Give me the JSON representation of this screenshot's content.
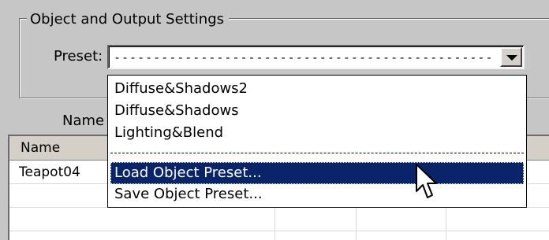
{
  "group": {
    "title": "Object and Output Settings"
  },
  "preset": {
    "label": "Preset:",
    "value": "-------------------------------------------------------------------------"
  },
  "name_label": "Name",
  "grid": {
    "column_header": "Name",
    "rows": [
      {
        "name": "Teapot04"
      }
    ]
  },
  "dropdown": {
    "items": [
      {
        "label": "Diffuse&Shadows2"
      },
      {
        "label": "Diffuse&Shadows"
      },
      {
        "label": "Lighting&Blend"
      },
      {
        "label": "Load Object Preset..."
      },
      {
        "label": "Save Object Preset..."
      }
    ],
    "selected_index": 3
  },
  "colors": {
    "selection": "#0a246a",
    "window": "#c6c6c6"
  },
  "icons": {
    "combo_arrow": "chevron-down-icon",
    "cursor": "mouse-pointer-icon"
  }
}
